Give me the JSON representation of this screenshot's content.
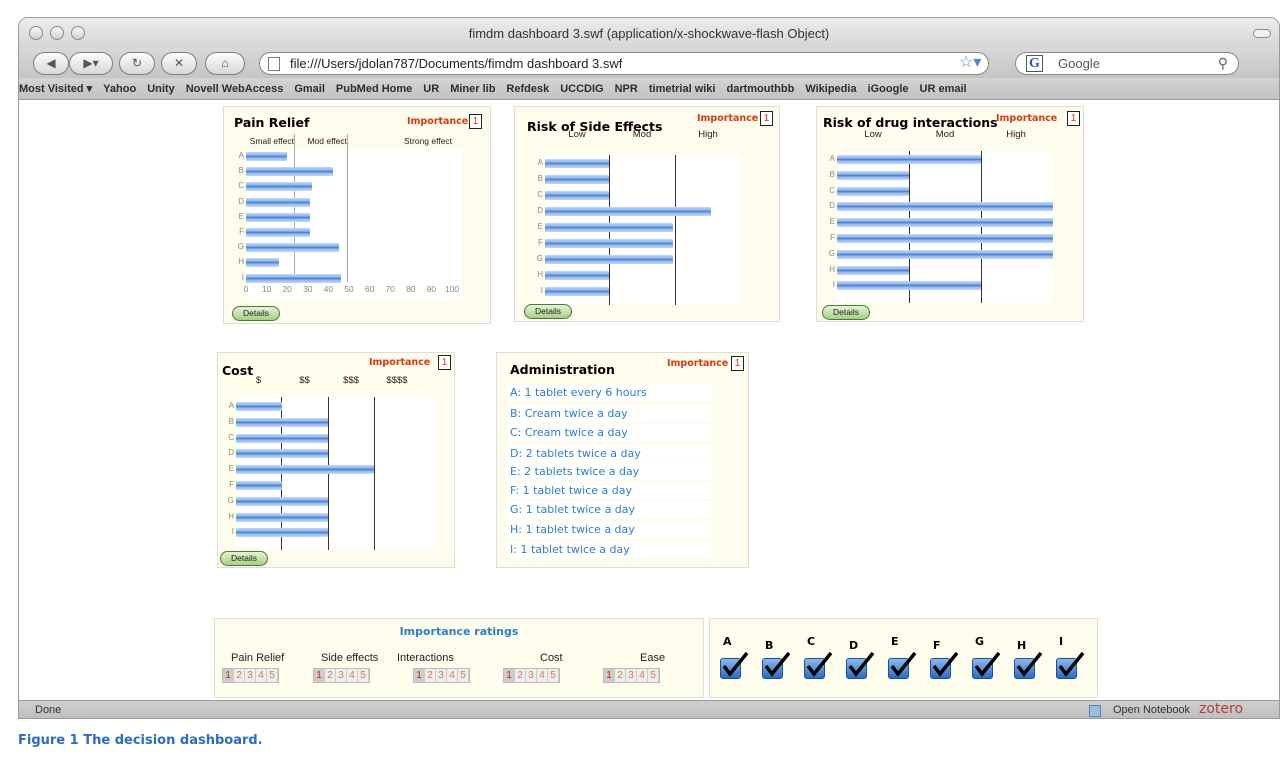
{
  "window": {
    "title": "fimdm dashboard 3.swf (application/x-shockwave-flash Object)"
  },
  "toolbar": {
    "url": "file:///Users/jdolan787/Documents/fimdm dashboard 3.swf",
    "search_placeholder": "Google"
  },
  "bookmarks": [
    "Most Visited ▾",
    "Yahoo",
    "Unity",
    "Novell WebAccess",
    "Gmail",
    "PubMed Home",
    "UR",
    "Miner lib",
    "Refdesk",
    "UCCDIG",
    "NPR",
    "timetrial wiki",
    "dartmouthbb",
    "Wikipedia",
    "iGoogle",
    "UR email"
  ],
  "common": {
    "importance_label": "Importance",
    "details_label": "Details",
    "row_labels": [
      "A",
      "B",
      "C",
      "D",
      "E",
      "F",
      "G",
      "H",
      "I"
    ]
  },
  "pain": {
    "title": "Pain Relief",
    "importance": "1",
    "columns": [
      "Small effect",
      "Mod effect",
      "Strong effect"
    ],
    "ticks": [
      "0",
      "10",
      "20",
      "30",
      "40",
      "50",
      "60",
      "70",
      "80",
      "90",
      "100"
    ],
    "values": [
      20,
      42,
      32,
      31,
      31,
      31,
      45,
      16,
      46
    ]
  },
  "side": {
    "title": "Risk of Side Effects",
    "importance": "1",
    "columns": [
      "Low",
      "Mod",
      "High"
    ],
    "values": [
      1,
      1,
      1,
      2.6,
      2,
      2,
      2,
      1,
      1
    ]
  },
  "inter": {
    "title": "Risk of drug interactions",
    "importance": "1",
    "columns": [
      "Low",
      "Mod",
      "High"
    ],
    "values": [
      2,
      1,
      1,
      3,
      3,
      3,
      3,
      1,
      2
    ]
  },
  "cost": {
    "title": "Cost",
    "importance": "1",
    "columns": [
      "$",
      "$$",
      "$$$",
      "$$$$"
    ],
    "values": [
      1,
      2,
      2,
      2,
      3,
      1,
      2,
      2,
      2
    ]
  },
  "admin": {
    "title": "Administration",
    "importance": "1",
    "rows": [
      "A: 1 tablet every 6 hours",
      "B: Cream twice a day",
      "C: Cream twice a day",
      "D: 2 tablets twice a day",
      "E: 2 tablets twice a day",
      "F: 1 tablet twice a day",
      "G: 1 tablet twice a day",
      "H: 1 tablet twice a day",
      "I: 1 tablet twice a day"
    ]
  },
  "ratings": {
    "title": "Importance ratings",
    "groups": [
      {
        "label": "Pain Relief",
        "selected": 1
      },
      {
        "label": "Side effects",
        "selected": 1
      },
      {
        "label": "Interactions",
        "selected": 1
      },
      {
        "label": "Cost",
        "selected": 1
      },
      {
        "label": "Ease",
        "selected": 1
      }
    ],
    "scale": [
      "1",
      "2",
      "3",
      "4",
      "5"
    ]
  },
  "checks": {
    "labels": [
      "A",
      "B",
      "C",
      "D",
      "E",
      "F",
      "G",
      "H",
      "I"
    ]
  },
  "status": {
    "left": "Done",
    "notebook": "Open Notebook",
    "zotero": "zotero"
  },
  "caption": {
    "bold": "Figure 1",
    "text": " The decision dashboard."
  }
}
